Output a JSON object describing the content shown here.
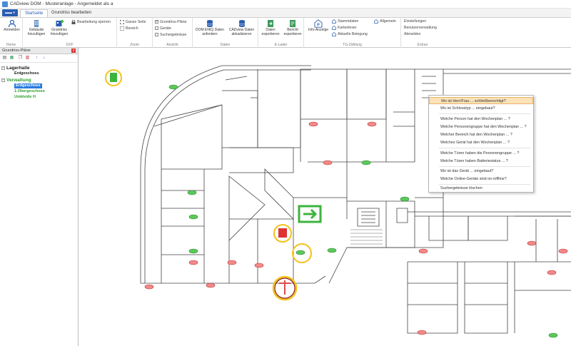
{
  "window": {
    "title": "CADview DOM - Musteranlage - Angemeldet als a"
  },
  "tabs": {
    "file": "▬▬ ▾",
    "start": "Startseite",
    "edit_plan": "Grundriss bearbeiten"
  },
  "ribbon": {
    "home": {
      "label": "Home",
      "login": "Anmelden"
    },
    "dxf": {
      "label": "DXF",
      "add_building": "Gebäude hinzufügen",
      "add_plan": "Grundriss hinzufügen",
      "lock_edit": "Bearbeitung sperren"
    },
    "zoom": {
      "label": "Zoom",
      "whole_page": "Ganze Seite",
      "area": "Bereich"
    },
    "view": {
      "label": "Ansicht",
      "floorplans": "Grundriss-Pläne",
      "devices": "Geräte",
      "search_results": "Suchergebnisse"
    },
    "data": {
      "label": "Daten",
      "retrieve": "DOM ENIQ Daten anfordern",
      "refresh": "CADview Daten aktualisieren"
    },
    "export": {
      "label": "E-Lader",
      "export_data": "Daten exportieren",
      "export_report": "Bericht exportieren"
    },
    "tg": {
      "label": "TG-Zählung",
      "info": "Info-Anzeige",
      "master": "Stammdaten",
      "cards": "Kartenleser",
      "occupancy": "Aktuelle Belegung",
      "general": "Allgemein"
    },
    "extras": {
      "label": "Extras",
      "settings": "Einstellungen",
      "users": "Benutzerverwaltung",
      "logout": "Abmelden"
    }
  },
  "sidebar": {
    "title": "Grundriss-Pläne",
    "close": "x",
    "tree": [
      {
        "label": "Lagerhalle",
        "level": 0,
        "color": "#1a1a1a",
        "bold": true
      },
      {
        "label": "Erdgeschoss",
        "level": 1,
        "color": "#1a1a1a",
        "bold": true
      },
      {
        "label": "Verwaltung",
        "level": 0,
        "color": "#2f9d2f",
        "bold": true
      },
      {
        "label": "Erdgeschoss",
        "level": 1,
        "color": "#ffffff",
        "bold": true,
        "selected": true
      },
      {
        "label": "1.Obergeschoss",
        "level": 1,
        "color": "#2f9d2f",
        "bold": true
      },
      {
        "label": "Umkleide H",
        "level": 1,
        "color": "#2f9d2f",
        "bold": true
      }
    ]
  },
  "context_menu": {
    "items": [
      "Wo ist Herr/Frau ... schließberechtigt?",
      "Wo ist Schlosstyp ... eingebaut?",
      "Welche Person hat den Wochenplan ... ?",
      "Welche Personengruppe hat den Wochenplan ... ?",
      "Welcher Bereich hat den Wochenplan ... ?",
      "Welches Gerät hat den Wochenplan ... ?",
      "Welche Türen haben die Personengruppe ... ?",
      "Welche Türen haben Batteriestatus ... ?",
      "Wo ist das Gerät ... eingebaut?",
      "Welche Online-Geräte sind on-/offline?",
      "Suchergebnisse löschen"
    ],
    "highlighted": 0
  },
  "colors": {
    "accent": "#2a5db0",
    "ok": "#3cb43c",
    "alarm": "#e04a4a",
    "ring": "#f3c21b"
  },
  "icons": {
    "exit": "exit-sign-icon"
  }
}
